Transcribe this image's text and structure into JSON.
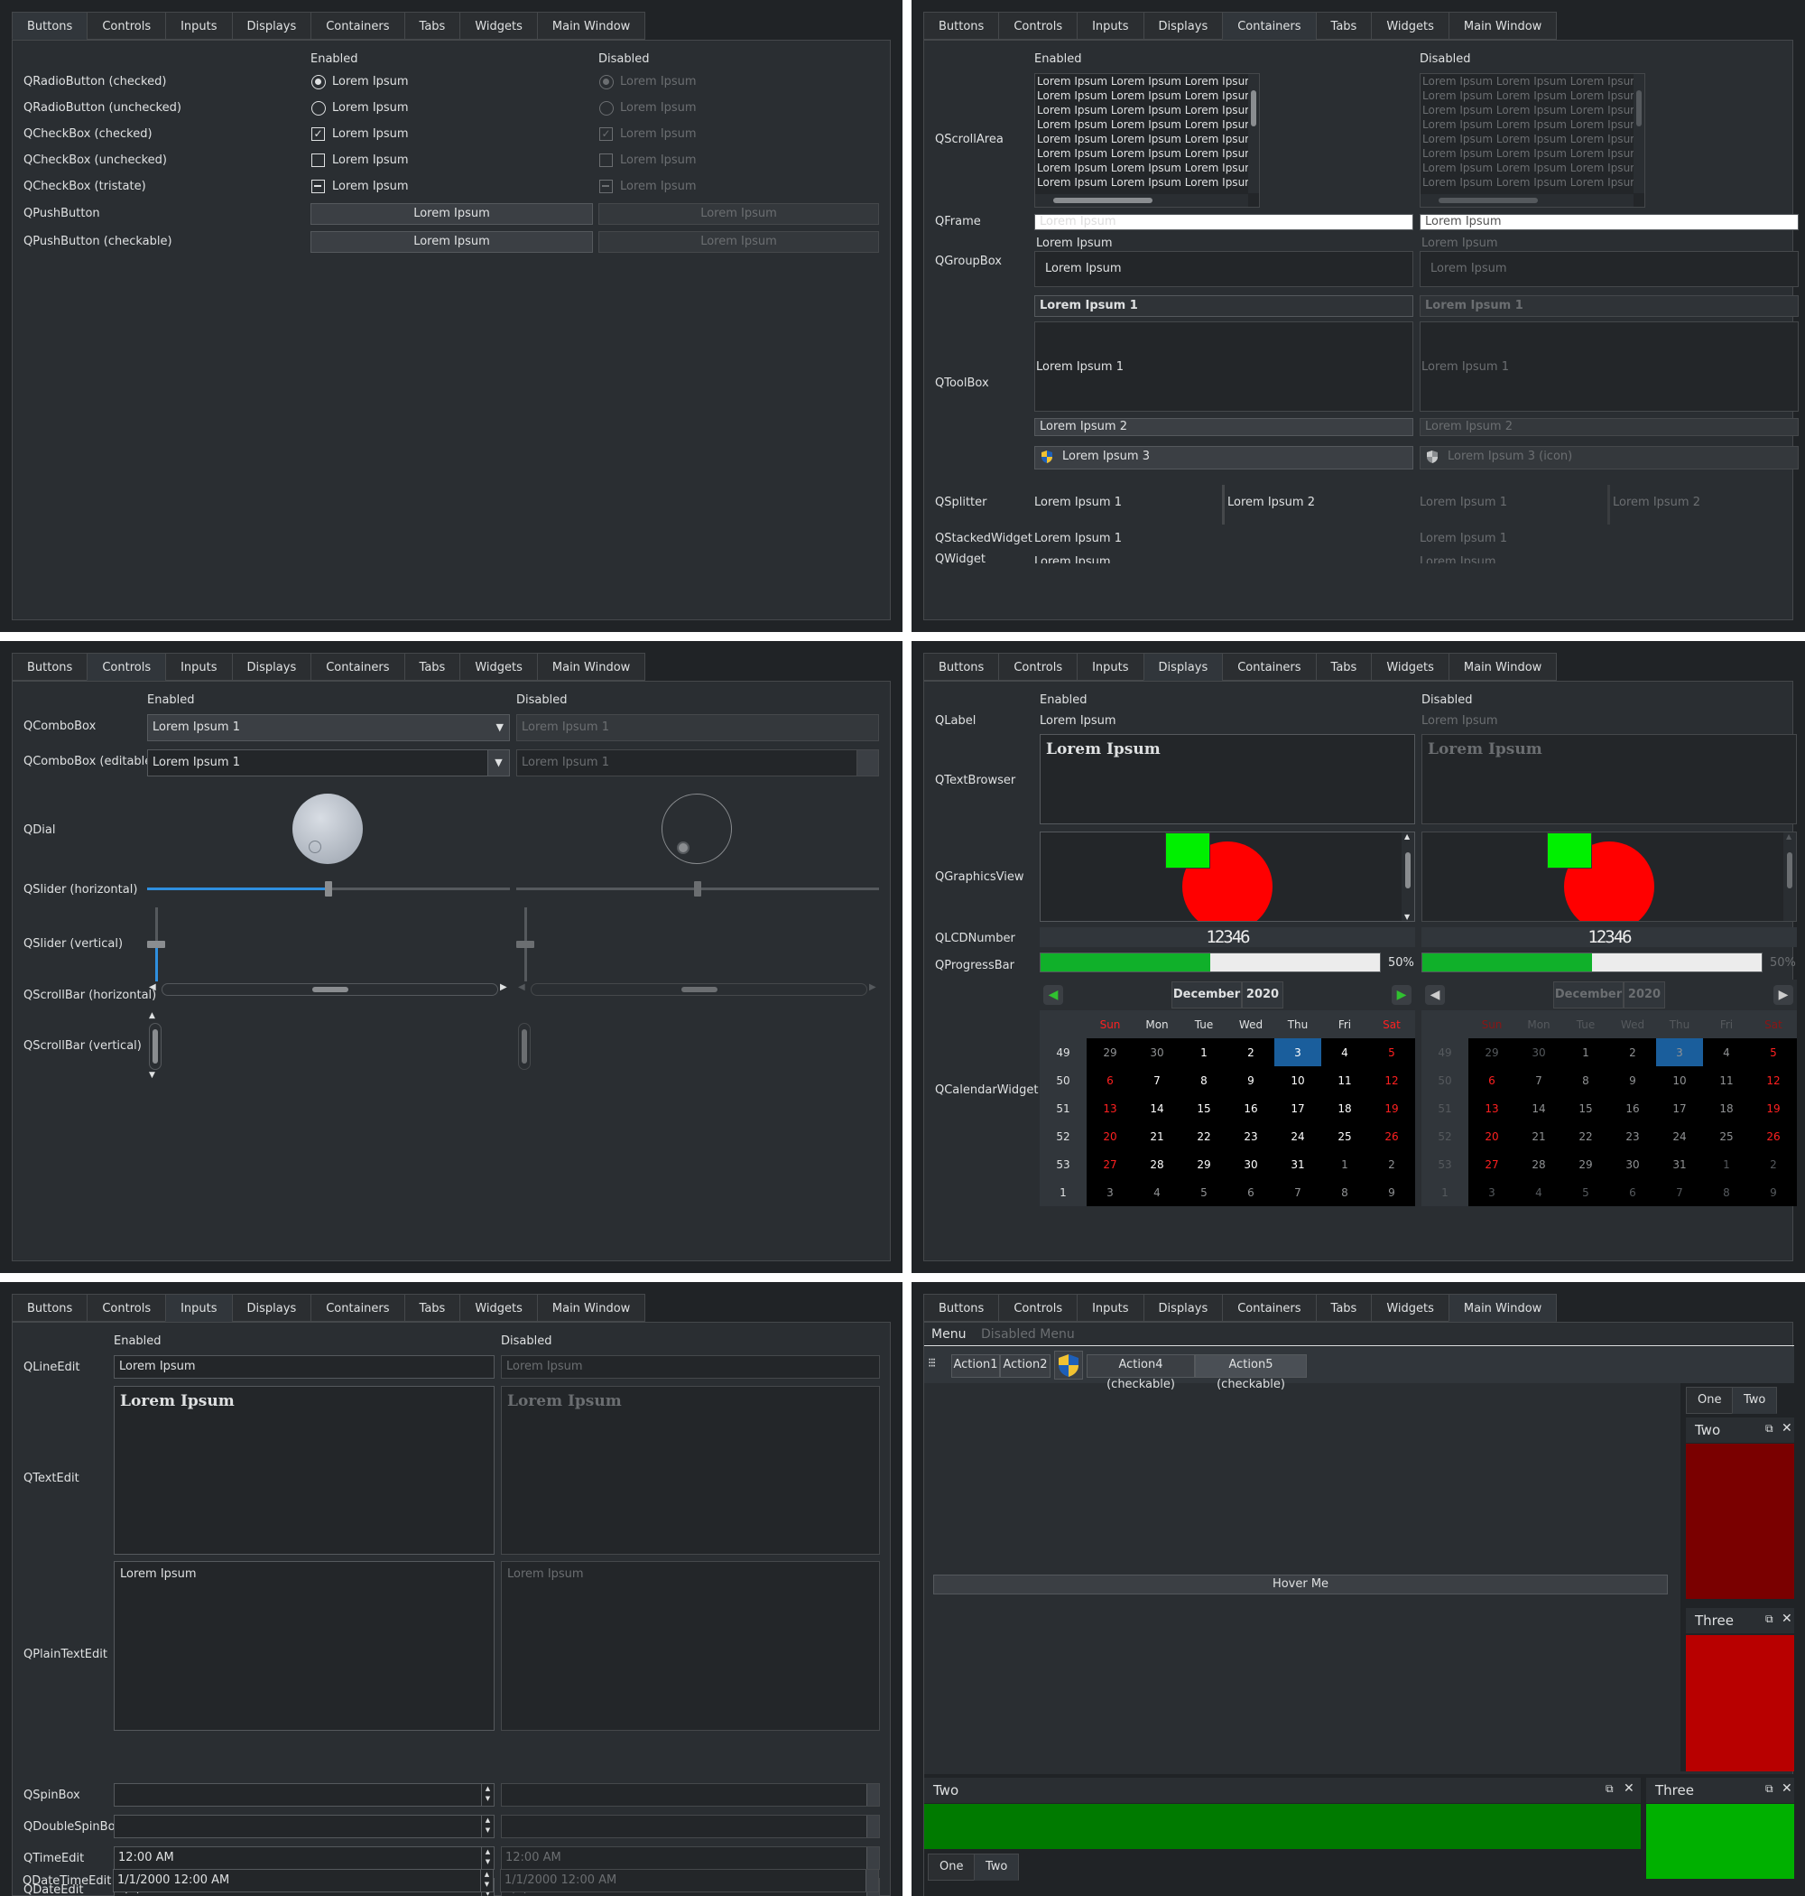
{
  "tabs": [
    "Buttons",
    "Controls",
    "Inputs",
    "Displays",
    "Containers",
    "Tabs",
    "Widgets",
    "Main Window"
  ],
  "common": {
    "enabled": "Enabled",
    "disabled": "Disabled",
    "lorem": "Lorem Ipsum",
    "lorem1": "Lorem Ipsum 1",
    "lorem2": "Lorem Ipsum 2",
    "lorem3": "Lorem Ipsum 3",
    "lorem3icon": "Lorem Ipsum 3 (icon)",
    "scroll_line": "Lorem Ipsum Lorem Ipsum Lorem Ipsum"
  },
  "buttons": {
    "rows": [
      "QRadioButton (checked)",
      "QRadioButton (unchecked)",
      "QCheckBox (checked)",
      "QCheckBox (unchecked)",
      "QCheckBox (tristate)",
      "QPushButton",
      "QPushButton (checkable)"
    ]
  },
  "containers": {
    "rows": [
      "QScrollArea",
      "QFrame",
      "QGroupBox",
      "QToolBox",
      "QSplitter",
      "QStackedWidget",
      "QWidget"
    ]
  },
  "controls": {
    "rows": [
      "QComboBox",
      "QComboBox (editable)",
      "QDial",
      "QSlider (horizontal)",
      "QSlider (vertical)",
      "QScrollBar (horizontal)",
      "QScrollBar (vertical)"
    ],
    "slider_value": 0.5,
    "dial_value": 0.0
  },
  "displays": {
    "rows": [
      "QLabel",
      "QTextBrowser",
      "QGraphicsView",
      "QLCDNumber",
      "QProgressBar",
      "QCalendarWidget"
    ],
    "lcd": "12346",
    "progress": 0.5,
    "progress_text": "50%",
    "month": "December",
    "year": "2020",
    "days": [
      "Sun",
      "Mon",
      "Tue",
      "Wed",
      "Thu",
      "Fri",
      "Sat"
    ],
    "weeks": [
      {
        "wk": "49",
        "d": [
          "29",
          "30",
          "1",
          "2",
          "3",
          "4",
          "5"
        ]
      },
      {
        "wk": "50",
        "d": [
          "6",
          "7",
          "8",
          "9",
          "10",
          "11",
          "12"
        ]
      },
      {
        "wk": "51",
        "d": [
          "13",
          "14",
          "15",
          "16",
          "17",
          "18",
          "19"
        ]
      },
      {
        "wk": "52",
        "d": [
          "20",
          "21",
          "22",
          "23",
          "24",
          "25",
          "26"
        ]
      },
      {
        "wk": "53",
        "d": [
          "27",
          "28",
          "29",
          "30",
          "31",
          "1",
          "2"
        ]
      },
      {
        "wk": "1",
        "d": [
          "3",
          "4",
          "5",
          "6",
          "7",
          "8",
          "9"
        ]
      }
    ]
  },
  "inputs": {
    "rows": [
      "QLineEdit",
      "QTextEdit",
      "QPlainTextEdit",
      "QSpinBox",
      "QDoubleSpinBox",
      "QTimeEdit",
      "QDateEdit",
      "QDateTimeEdit"
    ],
    "time": "12:00 AM",
    "date": "1/1/2000",
    "datetime": "1/1/2000 12:00 AM"
  },
  "mainwindow": {
    "menu": "Menu",
    "disabled_menu": "Disabled Menu",
    "actions": [
      "Action1",
      "Action2",
      "Action4 (checkable)",
      "Action5 (checkable)"
    ],
    "hover": "Hover Me",
    "dock_tabs": [
      "One",
      "Two"
    ],
    "dock_two": "Two",
    "dock_three": "Three",
    "colors": {
      "dark_red": "#7a0000",
      "red": "#b80000",
      "dark_green": "#007a00",
      "green": "#00b000"
    }
  }
}
